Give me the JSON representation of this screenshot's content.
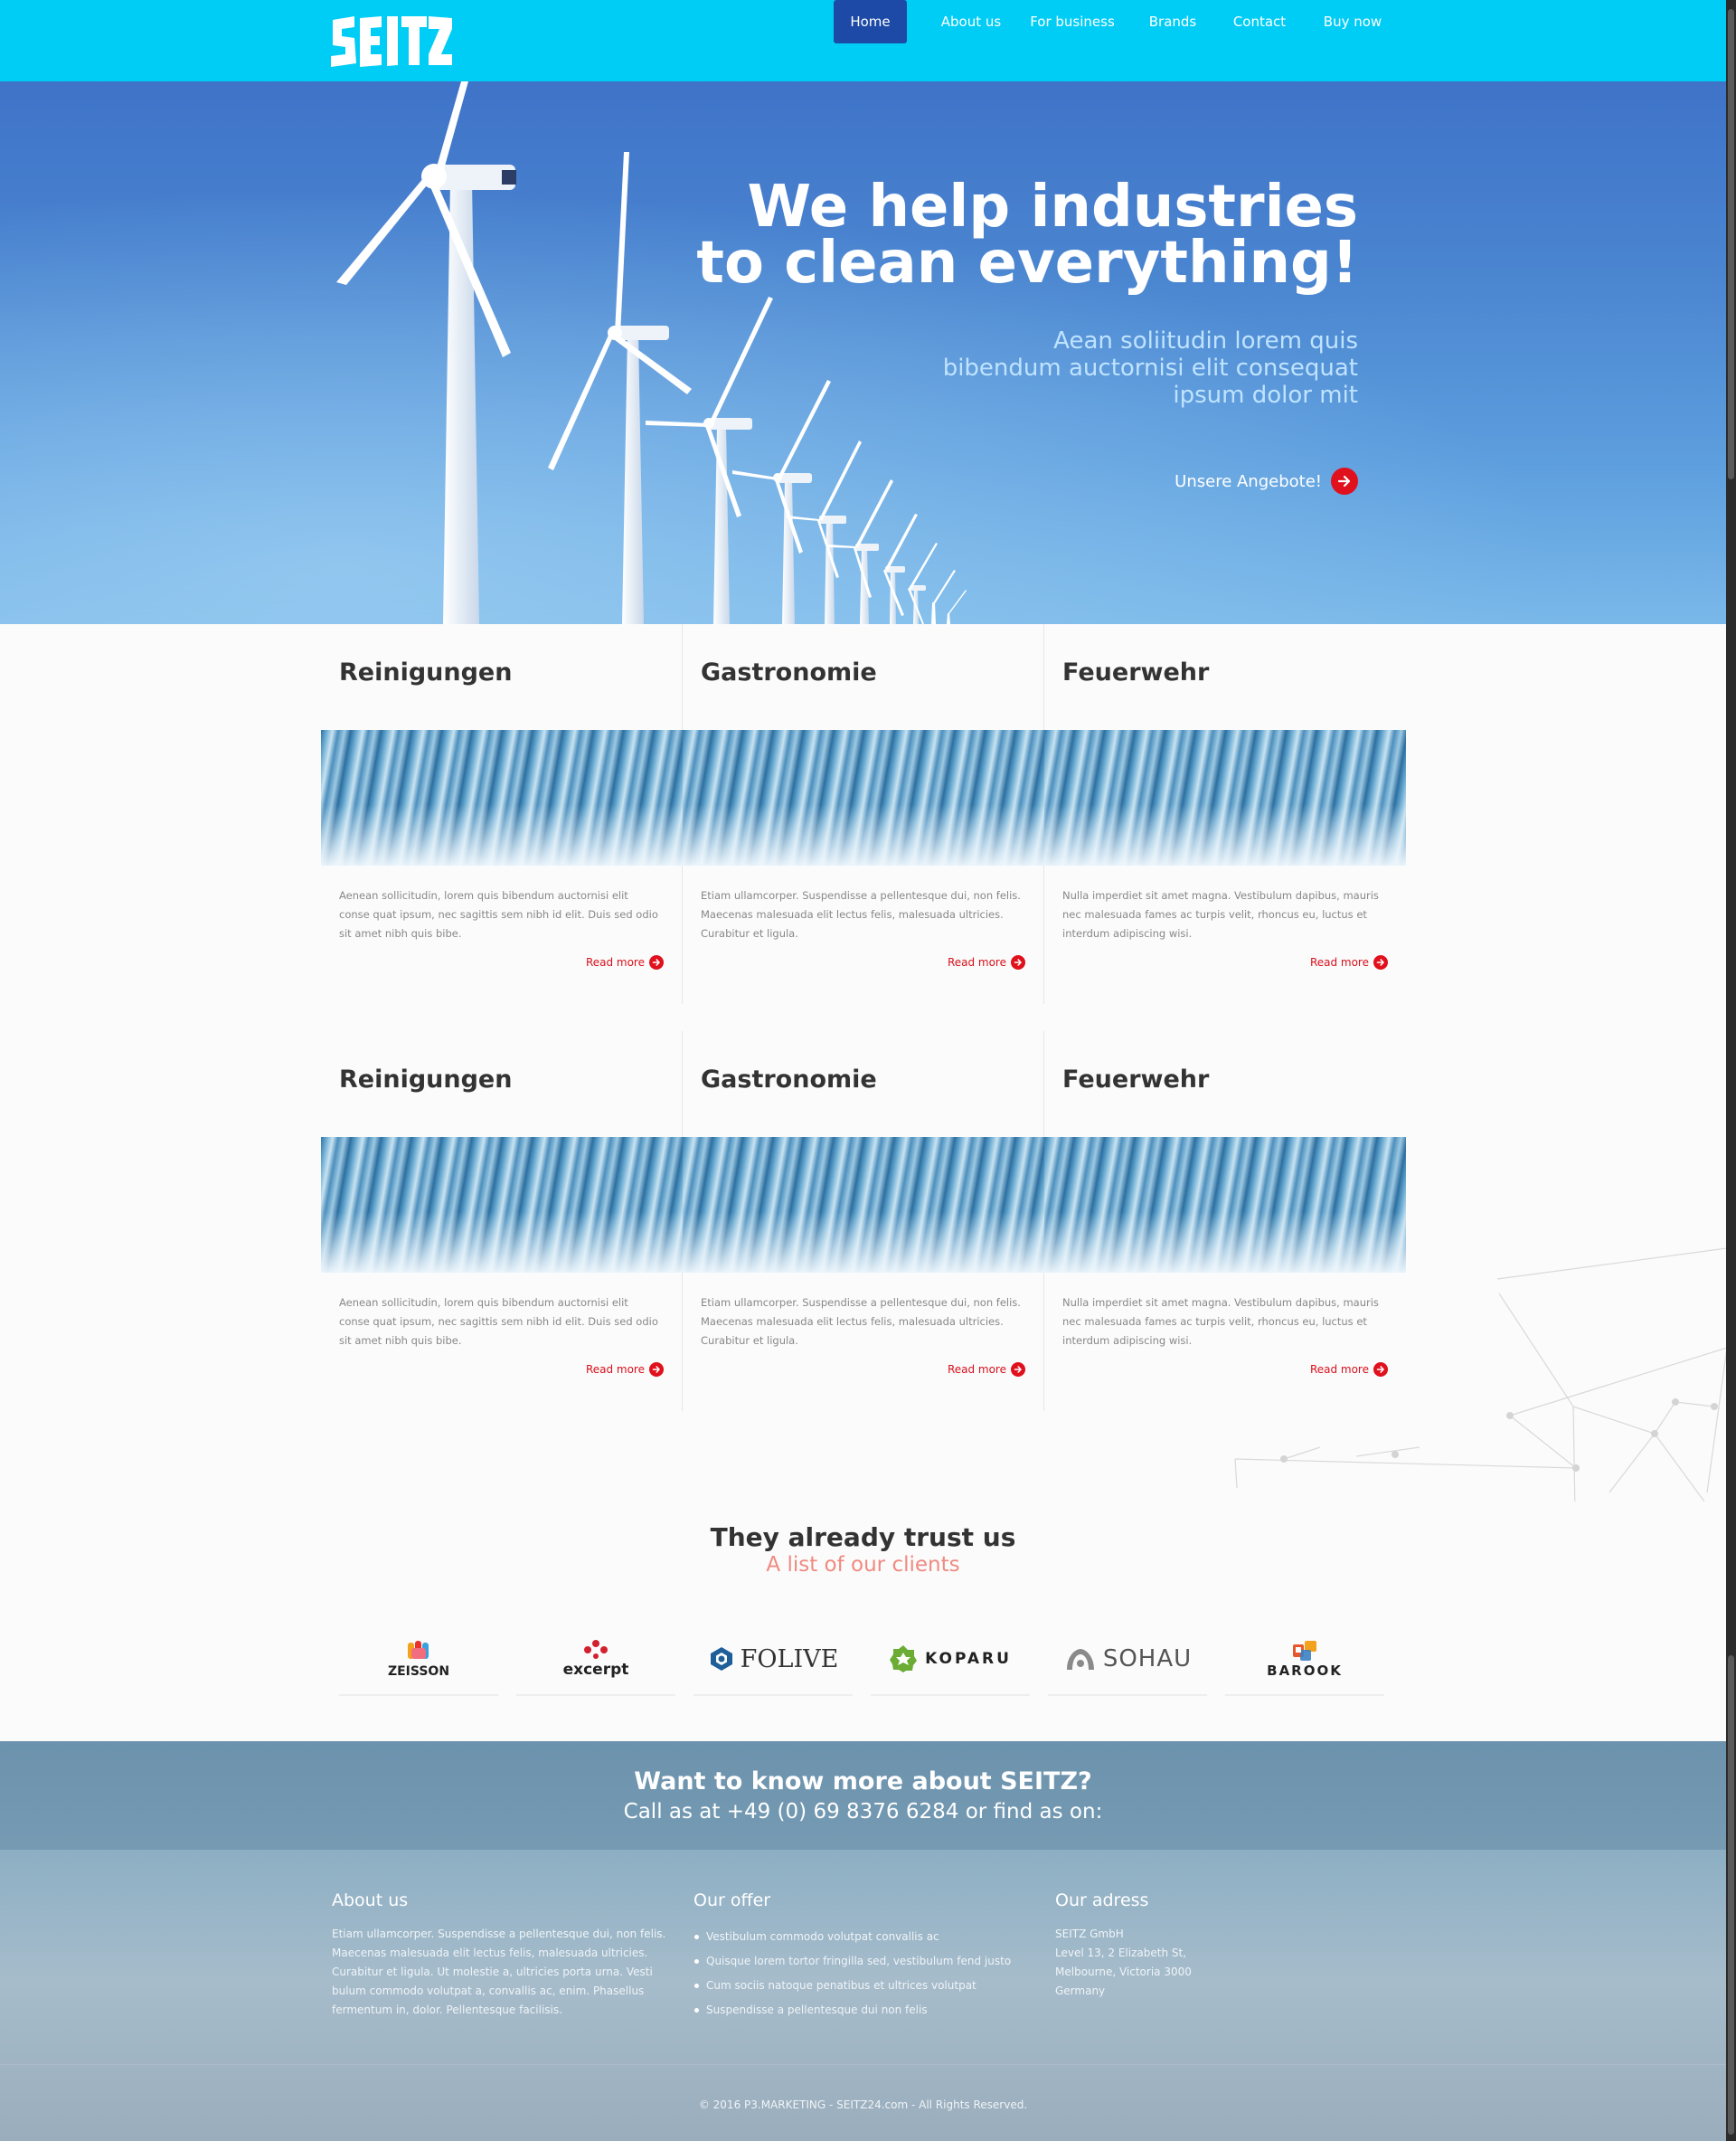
{
  "nav": {
    "logo": "SEITZ",
    "items": [
      {
        "label": "Home",
        "active": true
      },
      {
        "label": "About us"
      },
      {
        "label": "For business"
      },
      {
        "label": "Brands"
      },
      {
        "label": "Contact"
      },
      {
        "label": "Buy now"
      }
    ]
  },
  "hero": {
    "title_line1": "We help industries",
    "title_line2": "to clean everything!",
    "sub_line1": "Aean soliitudin lorem quis",
    "sub_line2": "bibendum auctornisi elit consequat",
    "sub_line3": "ipsum dolor mit",
    "cta": "Unsere Angebote!"
  },
  "cards": [
    {
      "title": "Reinigungen",
      "lines": [
        "Aenean sollicitudin, lorem quis bibendum auctornisi elit",
        "conse quat ipsum, nec sagittis sem nibh id elit. Duis sed odio",
        "sit amet nibh quis bibe."
      ],
      "read_more": "Read more"
    },
    {
      "title": "Gastronomie",
      "lines": [
        "Etiam ullamcorper. Suspendisse a pellentesque dui, non felis.",
        "Maecenas malesuada elit lectus felis, malesuada ultricies.",
        "Curabitur et ligula."
      ],
      "read_more": "Read more"
    },
    {
      "title": "Feuerwehr",
      "lines": [
        "Nulla imperdiet sit amet magna. Vestibulum dapibus, mauris",
        "nec malesuada fames ac turpis velit, rhoncus eu, luctus et",
        "interdum adipiscing wisi."
      ],
      "read_more": "Read more"
    },
    {
      "title": "Reinigungen",
      "lines": [
        "Aenean sollicitudin, lorem quis bibendum auctornisi elit",
        "conse quat ipsum, nec sagittis sem nibh id elit. Duis sed odio",
        "sit amet nibh quis bibe."
      ],
      "read_more": "Read more"
    },
    {
      "title": "Gastronomie",
      "lines": [
        "Etiam ullamcorper. Suspendisse a pellentesque dui, non felis.",
        "Maecenas malesuada elit lectus felis, malesuada ultricies.",
        "Curabitur et ligula."
      ],
      "read_more": "Read more"
    },
    {
      "title": "Feuerwehr",
      "lines": [
        "Nulla imperdiet sit amet magna. Vestibulum dapibus, mauris",
        "nec malesuada fames ac turpis velit, rhoncus eu, luctus et",
        "interdum adipiscing wisi."
      ],
      "read_more": "Read more"
    }
  ],
  "clients": {
    "title": "They already trust us",
    "subtitle": "A list of our clients",
    "logos": [
      "ZEISSON",
      "excerpt",
      "FOLIVE",
      "KOPARU",
      "SOHAU",
      "BAROOK"
    ]
  },
  "footer": {
    "headline": "Want to know more about SEITZ?",
    "call": "Call as at +49 (0) 69 8376 6284 or find as on:",
    "about": {
      "title": "About us",
      "lines": [
        "Etiam ullamcorper. Suspendisse a pellentesque dui, non felis.",
        "Maecenas malesuada elit lectus felis, malesuada ultricies.",
        "Curabitur et ligula. Ut molestie a, ultricies porta urna. Vesti",
        "bulum commodo volutpat a, convallis ac, enim. Phasellus",
        "fermentum in, dolor. Pellentesque facilisis."
      ]
    },
    "offer": {
      "title": "Our offer",
      "items": [
        "Vestibulum commodo volutpat convallis ac",
        "Quisque lorem tortor fringilla sed, vestibulum fend justo",
        "Cum sociis natoque penatibus et ultrices volutpat",
        "Suspendisse a pellentesque dui non felis"
      ]
    },
    "address": {
      "title": "Our adress",
      "lines": [
        "SEITZ GmbH",
        "Level 13, 2 Elizabeth St,",
        "Melbourne, Victoria 3000",
        "Germany"
      ]
    },
    "copyright": "© 2016 P3.MARKETING - SEITZ24.com - All Rights Reserved."
  },
  "colors": {
    "topbar": "#00cdf6",
    "nav_active": "#1d4aa6",
    "accent_red": "#e0101c",
    "client_sub": "#f08a80"
  }
}
